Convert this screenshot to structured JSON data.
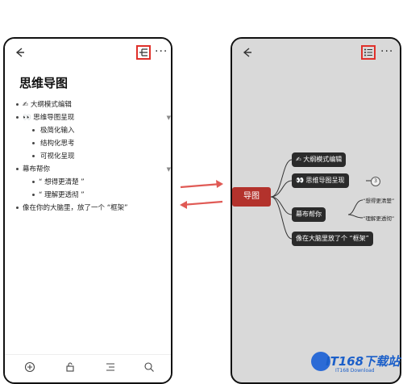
{
  "left_phone": {
    "title": "思维导图",
    "outline": [
      {
        "text": "✍ 大纲模式编辑",
        "level": 0
      },
      {
        "text": "👀 思维导图呈现",
        "level": 0,
        "collapsible": true
      },
      {
        "text": "极简化输入",
        "level": 1
      },
      {
        "text": "结构化思考",
        "level": 1
      },
      {
        "text": "可视化呈现",
        "level": 1
      },
      {
        "text": "幕布帮你",
        "level": 0,
        "collapsible": true
      },
      {
        "text": "“ 想得更清楚 ”",
        "level": 1
      },
      {
        "text": "“ 理解更透彻 ”",
        "level": 1
      },
      {
        "text": "像在你的大脑里，放了一个 “框架”",
        "level": 0
      }
    ],
    "bottom_icons": [
      "add-icon",
      "lock-icon",
      "indent-list-icon",
      "search-icon"
    ]
  },
  "right_phone": {
    "root": "导图",
    "nodes": {
      "n1": "✍ 大纲模式编辑",
      "n2": "👀 思维导图呈现",
      "n3": "幕布帮你",
      "n4": "像在大脑里放了个 “框架”"
    },
    "badge": "3",
    "leaves": {
      "l1": "“想得更清楚”",
      "l2": "“理解更透彻”"
    }
  },
  "watermark": {
    "main": "IT168下载站",
    "sub": "IT168 Download"
  },
  "colors": {
    "highlight": "#e0302a",
    "root_node": "#b3322c",
    "dark_node": "#2b2b2b",
    "arrow": "#e05a55"
  }
}
